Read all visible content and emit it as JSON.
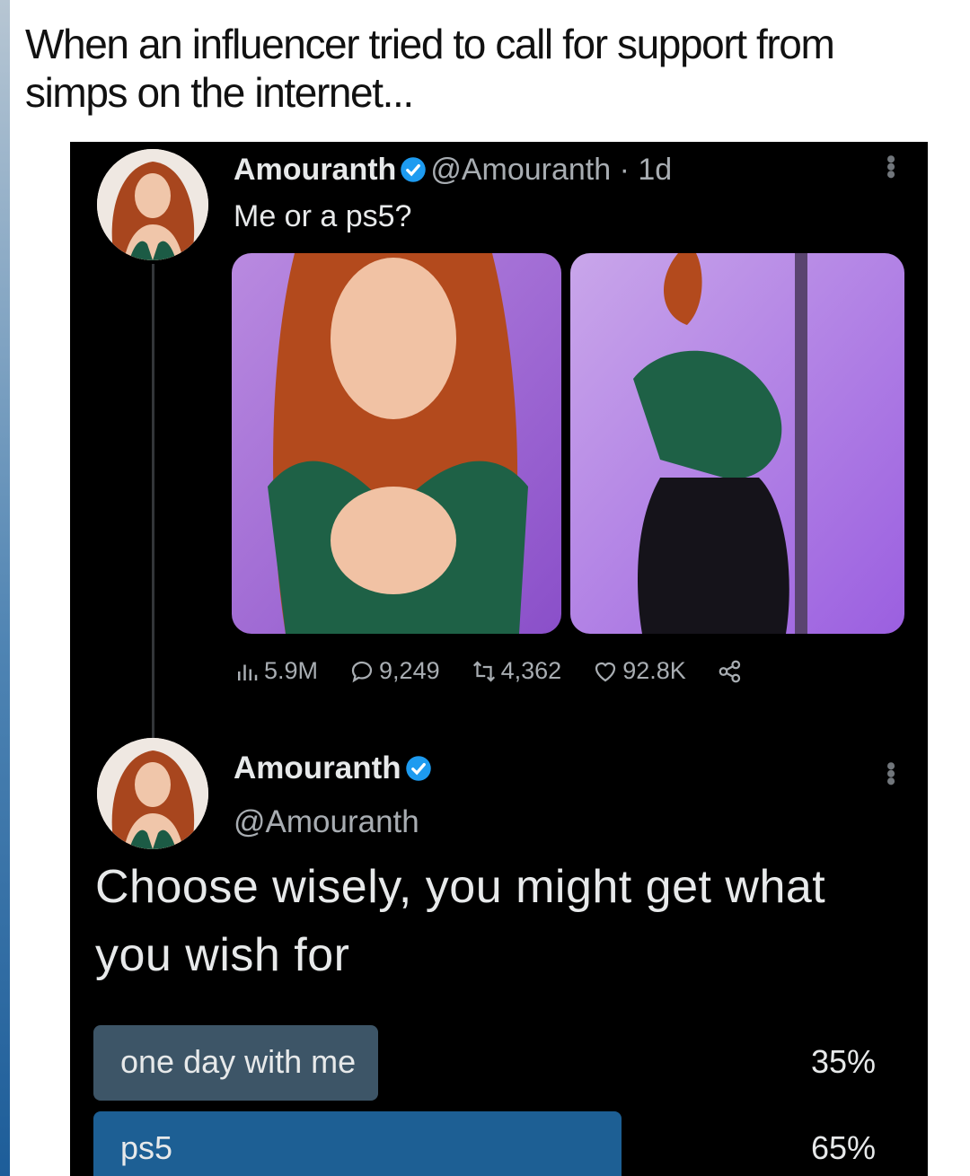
{
  "caption": "When an influencer tried to call for support from simps on the internet...",
  "tweet1": {
    "name": "Amouranth",
    "handle": "@Amouranth",
    "time": "1d",
    "text": "Me or a ps5?",
    "stats": {
      "views": "5.9M",
      "replies": "9,249",
      "retweets": "4,362",
      "likes": "92.8K"
    }
  },
  "tweet2": {
    "name": "Amouranth",
    "handle": "@Amouranth",
    "text": "Choose wisely, you might get what you wish for",
    "poll": [
      {
        "label": "one day with me",
        "percent": "35%",
        "fraction": 0.35
      },
      {
        "label": "ps5",
        "percent": "65%",
        "fraction": 0.65
      }
    ]
  },
  "colors": {
    "panel_bg": "#000000",
    "verified": "#1d9bf0",
    "poll_loser": "#3d5567",
    "poll_winner": "#1d5f94",
    "muted_text": "#a8adb2"
  },
  "icons": [
    "verified-badge-icon",
    "more-options-icon",
    "views-icon",
    "reply-icon",
    "retweet-icon",
    "like-icon",
    "share-icon"
  ]
}
